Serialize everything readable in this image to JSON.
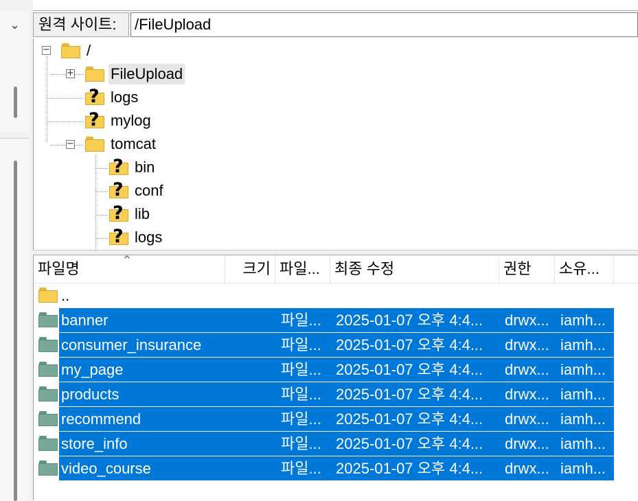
{
  "window": {
    "left_pane_dropdown_icon": "chevron-down-icon"
  },
  "remote_site": {
    "label": "원격 사이트:",
    "path": "/FileUpload"
  },
  "tree": {
    "root": "/",
    "items": [
      {
        "label": "FileUpload",
        "icon": "folder-icon",
        "expander": "+",
        "selected": true
      },
      {
        "label": "logs",
        "icon": "unknown-folder-icon"
      },
      {
        "label": "mylog",
        "icon": "unknown-folder-icon"
      },
      {
        "label": "tomcat",
        "icon": "folder-icon",
        "expander": "−"
      },
      {
        "label": "bin",
        "icon": "unknown-folder-icon"
      },
      {
        "label": "conf",
        "icon": "unknown-folder-icon"
      },
      {
        "label": "lib",
        "icon": "unknown-folder-icon"
      },
      {
        "label": "logs",
        "icon": "unknown-folder-icon"
      }
    ]
  },
  "file_list": {
    "columns": [
      "파일명",
      "크기",
      "파일...",
      "최종 수정",
      "권한",
      "소유..."
    ],
    "sort_indicator": "^",
    "rows": [
      {
        "name": "..",
        "size": "",
        "type": "",
        "modified": "",
        "perms": "",
        "owner": "",
        "selected": false,
        "icon": "yellow"
      },
      {
        "name": "banner",
        "size": "",
        "type": "파일...",
        "modified": "2025-01-07 오후 4:4...",
        "perms": "drwx...",
        "owner": "iamh...",
        "selected": true,
        "icon": "teal"
      },
      {
        "name": "consumer_insurance",
        "size": "",
        "type": "파일...",
        "modified": "2025-01-07 오후 4:4...",
        "perms": "drwx...",
        "owner": "iamh...",
        "selected": true,
        "icon": "teal"
      },
      {
        "name": "my_page",
        "size": "",
        "type": "파일...",
        "modified": "2025-01-07 오후 4:4...",
        "perms": "drwx...",
        "owner": "iamh...",
        "selected": true,
        "icon": "teal"
      },
      {
        "name": "products",
        "size": "",
        "type": "파일...",
        "modified": "2025-01-07 오후 4:4...",
        "perms": "drwx...",
        "owner": "iamh...",
        "selected": true,
        "icon": "teal"
      },
      {
        "name": "recommend",
        "size": "",
        "type": "파일...",
        "modified": "2025-01-07 오후 4:4...",
        "perms": "drwx...",
        "owner": "iamh...",
        "selected": true,
        "icon": "teal"
      },
      {
        "name": "store_info",
        "size": "",
        "type": "파일...",
        "modified": "2025-01-07 오후 4:4...",
        "perms": "drwx...",
        "owner": "iamh...",
        "selected": true,
        "icon": "teal"
      },
      {
        "name": "video_course",
        "size": "",
        "type": "파일...",
        "modified": "2025-01-07 오후 4:4...",
        "perms": "drwx...",
        "owner": "iamh...",
        "selected": true,
        "icon": "teal"
      }
    ]
  },
  "colors": {
    "selection": "#0078d7",
    "folder_yellow": "#f8cf52",
    "folder_teal": "#7aa898"
  }
}
